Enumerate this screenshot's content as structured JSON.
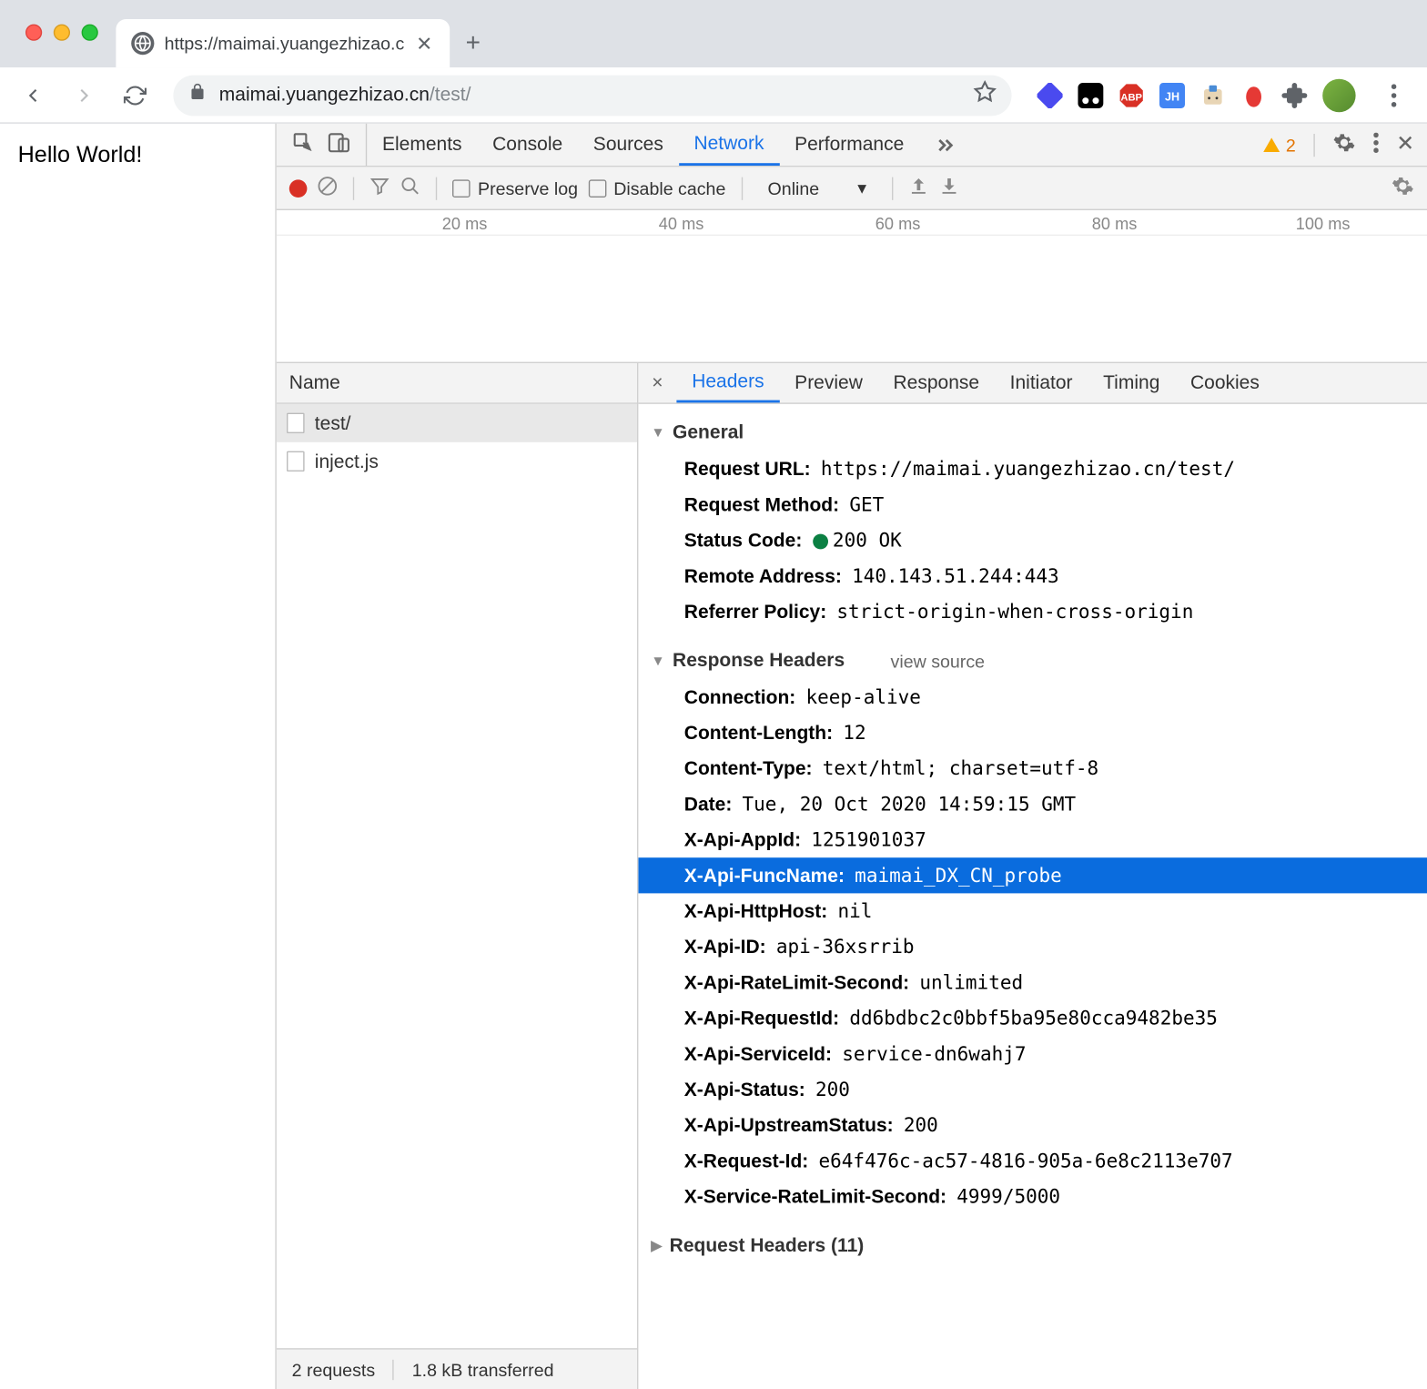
{
  "browser": {
    "tab_title": "https://maimai.yuangezhizao.c",
    "url_host": "maimai.yuangezhizao.cn",
    "url_path": "/test/"
  },
  "page": {
    "content": "Hello World!"
  },
  "devtools": {
    "tabs": [
      "Elements",
      "Console",
      "Sources",
      "Network",
      "Performance"
    ],
    "active_tab": "Network",
    "warnings": 2,
    "net_toolbar": {
      "preserve_log": "Preserve log",
      "disable_cache": "Disable cache",
      "throttling": "Online"
    },
    "timeline_ticks": [
      "20 ms",
      "40 ms",
      "60 ms",
      "80 ms",
      "100 ms"
    ],
    "requests": {
      "header": "Name",
      "items": [
        "test/",
        "inject.js"
      ],
      "selected": 0
    },
    "detail_tabs": [
      "Headers",
      "Preview",
      "Response",
      "Initiator",
      "Timing",
      "Cookies"
    ],
    "active_detail": "Headers",
    "general": {
      "title": "General",
      "rows": [
        {
          "k": "Request URL:",
          "v": "https://maimai.yuangezhizao.cn/test/"
        },
        {
          "k": "Request Method:",
          "v": "GET"
        },
        {
          "k": "Status Code:",
          "v": "200 OK",
          "status": true
        },
        {
          "k": "Remote Address:",
          "v": "140.143.51.244:443"
        },
        {
          "k": "Referrer Policy:",
          "v": "strict-origin-when-cross-origin"
        }
      ]
    },
    "response_headers": {
      "title": "Response Headers",
      "view_source": "view source",
      "rows": [
        {
          "k": "Connection:",
          "v": "keep-alive"
        },
        {
          "k": "Content-Length:",
          "v": "12"
        },
        {
          "k": "Content-Type:",
          "v": "text/html; charset=utf-8"
        },
        {
          "k": "Date:",
          "v": "Tue, 20 Oct 2020 14:59:15 GMT"
        },
        {
          "k": "X-Api-AppId:",
          "v": "1251901037"
        },
        {
          "k": "X-Api-FuncName:",
          "v": "maimai_DX_CN_probe",
          "highlighted": true
        },
        {
          "k": "X-Api-HttpHost:",
          "v": "nil"
        },
        {
          "k": "X-Api-ID:",
          "v": "api-36xsrrib"
        },
        {
          "k": "X-Api-RateLimit-Second:",
          "v": "unlimited"
        },
        {
          "k": "X-Api-RequestId:",
          "v": "dd6bdbc2c0bbf5ba95e80cca9482be35"
        },
        {
          "k": "X-Api-ServiceId:",
          "v": "service-dn6wahj7"
        },
        {
          "k": "X-Api-Status:",
          "v": "200"
        },
        {
          "k": "X-Api-UpstreamStatus:",
          "v": "200"
        },
        {
          "k": "X-Request-Id:",
          "v": "e64f476c-ac57-4816-905a-6e8c2113e707"
        },
        {
          "k": "X-Service-RateLimit-Second:",
          "v": "4999/5000"
        }
      ]
    },
    "request_headers": {
      "title": "Request Headers (11)"
    },
    "status_bar": {
      "requests": "2 requests",
      "transferred": "1.8 kB transferred"
    }
  }
}
